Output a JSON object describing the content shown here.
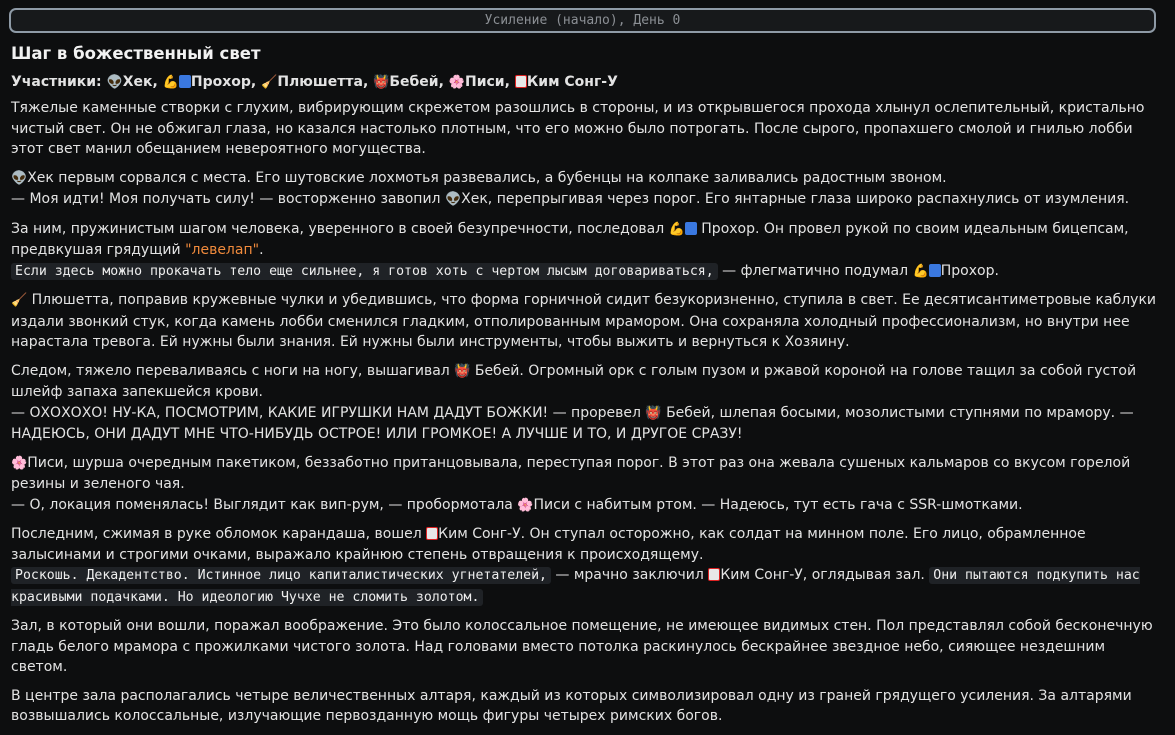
{
  "header": {
    "title": "Усиление (начало), День 0"
  },
  "scene": {
    "title": "Шаг в божественный свет",
    "participants_label": "Участники:",
    "participants": [
      "Хек,",
      "Прохор,",
      "Плюшетта,",
      "Бебей,",
      "Писи,",
      "Ким Сонг-У"
    ]
  },
  "icons": {
    "hek": "alien-icon",
    "prokhor": "flexed-biceps-icon",
    "plyushetta": "broom-icon",
    "bebey": "devil-icon",
    "pisi": "flower-icon",
    "kim": "mahjong-tile-icon"
  },
  "p1": "Тяжелые каменные створки с глухим, вибрирующим скрежетом разошлись в стороны, и из открывшегося прохода хлынул ослепительный, кристально чистый свет. Он не обжигал глаза, но казался настолько плотным, что его можно было потрогать. После сырого, пропахшего смолой и гнилью лобби этот свет манил обещанием невероятного могущества.",
  "p2": {
    "a": "Хек первым сорвался с места. Его шутовские лохмотья развевались, а бубенцы на колпаке заливались радостным звоном.",
    "b": "— Моя идти! Моя получать силу! — восторженно завопил",
    "c": "Хек, перепрыгивая через порог. Его янтарные глаза широко распахнулись от изумления."
  },
  "p3": {
    "a": "За ним, пружинистым шагом человека, уверенного в своей безупречности, последовал",
    "b": "Прохор. Он провел рукой по своим идеальным бицепсам, предвкушая грядущий",
    "c": "\"левелап\"",
    "d": ".",
    "mono": "Если здесь можно прокачать тело еще сильнее, я готов хоть с чертом лысым договариваться,",
    "e": "— флегматично подумал",
    "f": "Прохор."
  },
  "p4": "Плюшетта, поправив кружевные чулки и убедившись, что форма горничной сидит безукоризненно, ступила в свет. Ее десятисантиметровые каблуки издали звонкий стук, когда камень лобби сменился гладким, отполированным мрамором. Она сохраняла холодный профессионализм, но внутри нее нарастала тревога. Ей нужны были знания. Ей нужны были инструменты, чтобы выжить и вернуться к Хозяину.",
  "p5": {
    "a": "Следом, тяжело переваливаясь с ноги на ногу, вышагивал",
    "b": "Бебей. Огромный орк с голым пузом и ржавой короной на голове тащил за собой густой шлейф запаха запекшейся крови.",
    "c": "— ОХОХОХО! НУ-КА, ПОСМОТРИМ, КАКИЕ ИГРУШКИ НАМ ДАДУТ БОЖКИ! — проревел",
    "d": "Бебей, шлепая босыми, мозолистыми ступнями по мрамору. — НАДЕЮСЬ, ОНИ ДАДУТ МНЕ ЧТО-НИБУДЬ ОСТРОЕ! ИЛИ ГРОМКОЕ! А ЛУЧШЕ И ТО, И ДРУГОЕ СРАЗУ!"
  },
  "p6": {
    "a": "Писи, шурша очередным пакетиком, беззаботно пританцовывала, переступая порог. В этот раз она жевала сушеных кальмаров со вкусом горелой резины и зеленого чая.",
    "b": "— О, локация поменялась! Выглядит как вип-рум, — пробормотала",
    "c": "Писи с набитым ртом. — Надеюсь, тут есть гача с SSR-шмотками."
  },
  "p7": {
    "a": "Последним, сжимая в руке обломок карандаша, вошел",
    "b": "Ким Сонг-У. Он ступал осторожно, как солдат на минном поле. Его лицо, обрамленное залысинами и строгими очками, выражало крайнюю степень отвращения к происходящему.",
    "mono1": "Роскошь. Декадентство. Истинное лицо капиталистических угнетателей,",
    "c": "— мрачно заключил",
    "d": "Ким Сонг-У, оглядывая зал.",
    "mono2": "Они пытаются подкупить нас красивыми подачками. Но идеологию Чучхе не сломить золотом."
  },
  "p8": "Зал, в который они вошли, поражал воображение. Это было колоссальное помещение, не имеющее видимых стен. Пол представлял собой бесконечную гладь белого мрамора с прожилками чистого золота. Над головами вместо потолка раскинулось бескрайнее звездное небо, сияющее нездешним светом.",
  "p9": "В центре зала располагались четыре величественных алтаря, каждый из которых символизировал одну из граней грядущего усиления. За алтарями возвышались колоссальные, излучающие первозданную мощь фигуры четырех римских богов."
}
